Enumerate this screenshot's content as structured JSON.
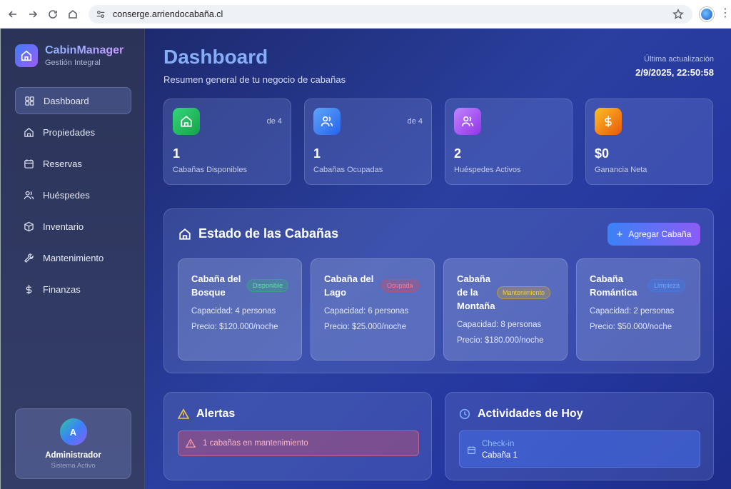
{
  "browser": {
    "url": "conserge.arriendocabaña.cl"
  },
  "sidebar": {
    "brand_title": "CabinManager",
    "brand_subtitle": "Gestión Integral",
    "items": [
      {
        "label": "Dashboard",
        "icon": "grid-icon",
        "active": true
      },
      {
        "label": "Propiedades",
        "icon": "home-icon"
      },
      {
        "label": "Reservas",
        "icon": "calendar-icon"
      },
      {
        "label": "Huéspedes",
        "icon": "users-icon"
      },
      {
        "label": "Inventario",
        "icon": "box-icon"
      },
      {
        "label": "Mantenimiento",
        "icon": "wrench-icon"
      },
      {
        "label": "Finanzas",
        "icon": "dollar-icon"
      }
    ],
    "user": {
      "initial": "A",
      "name": "Administrador",
      "status": "Sistema Activo"
    }
  },
  "header": {
    "title": "Dashboard",
    "subtitle": "Resumen general de tu negocio de cabañas",
    "update_label": "Última actualización",
    "update_time": "2/9/2025, 22:50:58"
  },
  "stats": [
    {
      "value": "1",
      "label": "Cabañas Disponibles",
      "of": "de 4",
      "icon": "home-icon",
      "color": "#22c55e"
    },
    {
      "value": "1",
      "label": "Cabañas Ocupadas",
      "of": "de 4",
      "icon": "users-icon",
      "color": "#3b82f6"
    },
    {
      "value": "2",
      "label": "Huéspedes Activos",
      "of": "",
      "icon": "users-icon",
      "color": "#a855f7"
    },
    {
      "value": "$0",
      "label": "Ganancia Neta",
      "of": "",
      "icon": "dollar-icon",
      "color": "#f59e0b"
    }
  ],
  "cabins_panel": {
    "title": "Estado de las Cabañas",
    "add_button": "Agregar Cabaña",
    "cabins": [
      {
        "name": "Cabaña del Bosque",
        "status": "Disponible",
        "capacity": "Capacidad: 4 personas",
        "price": "Precio: $120.000/noche"
      },
      {
        "name": "Cabaña del Lago",
        "status": "Ocupada",
        "capacity": "Capacidad: 6 personas",
        "price": "Precio: $25.000/noche"
      },
      {
        "name": "Cabaña de la Montaña",
        "status": "Mantenimiento",
        "capacity": "Capacidad: 8 personas",
        "price": "Precio: $180.000/noche"
      },
      {
        "name": "Cabaña Romántica",
        "status": "Limpieza",
        "capacity": "Capacidad: 2 personas",
        "price": "Precio: $50.000/noche"
      }
    ]
  },
  "alerts": {
    "title": "Alertas",
    "items": [
      "1 cabañas en mantenimiento"
    ]
  },
  "activities": {
    "title": "Actividades de Hoy",
    "items": [
      {
        "type": "Check-in",
        "cabin": "Cabaña 1"
      }
    ]
  }
}
